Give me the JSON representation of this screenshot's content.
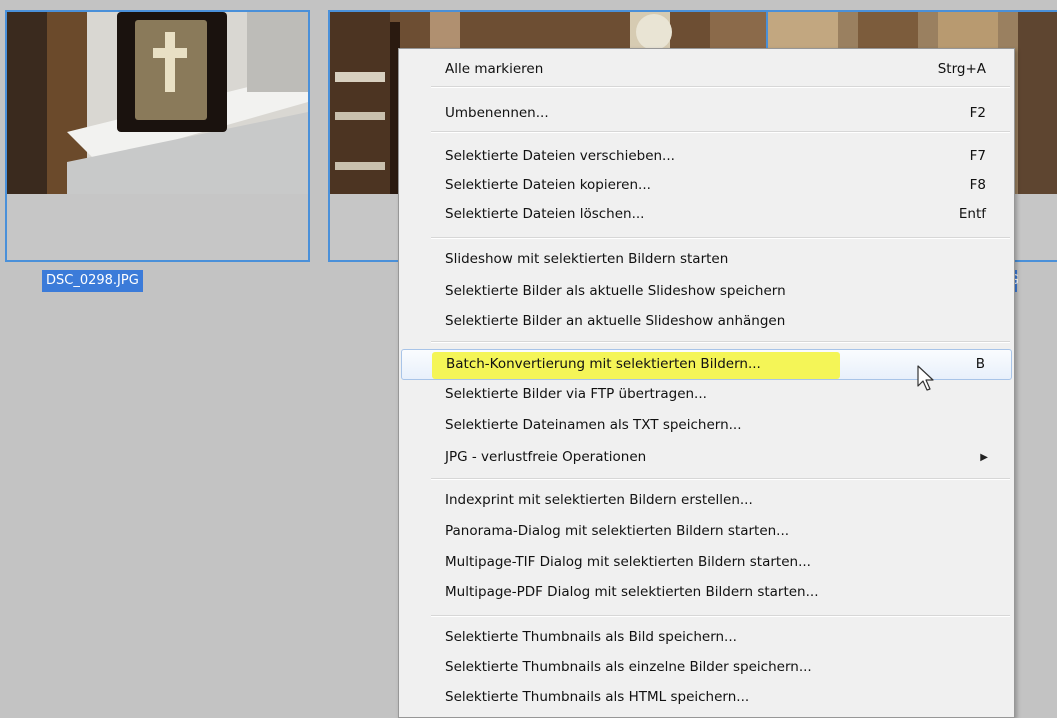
{
  "thumbnails": [
    {
      "filename": "DSC_0298.JPG"
    },
    {
      "filename": ""
    },
    {
      "filename": "PG"
    }
  ],
  "menu": {
    "items": [
      {
        "label": "Alle markieren",
        "shortcut": "Strg+A"
      },
      {
        "label": "Umbenennen...",
        "shortcut": "F2"
      },
      {
        "label": "Selektierte Dateien verschieben...",
        "shortcut": "F7"
      },
      {
        "label": "Selektierte Dateien kopieren...",
        "shortcut": "F8"
      },
      {
        "label": "Selektierte Dateien löschen...",
        "shortcut": "Entf"
      },
      {
        "label": "Slideshow mit selektierten Bildern starten",
        "shortcut": ""
      },
      {
        "label": "Selektierte Bilder als aktuelle Slideshow speichern",
        "shortcut": ""
      },
      {
        "label": "Selektierte Bilder an aktuelle Slideshow anhängen",
        "shortcut": ""
      },
      {
        "label": "Batch-Konvertierung mit selektierten Bildern...",
        "shortcut": "B"
      },
      {
        "label": "Selektierte Bilder via FTP übertragen...",
        "shortcut": ""
      },
      {
        "label": "Selektierte Dateinamen als TXT speichern...",
        "shortcut": ""
      },
      {
        "label": "JPG - verlustfreie Operationen",
        "shortcut": "",
        "submenu": true
      },
      {
        "label": "Indexprint mit selektierten Bildern erstellen...",
        "shortcut": ""
      },
      {
        "label": "Panorama-Dialog mit selektierten Bildern starten...",
        "shortcut": ""
      },
      {
        "label": "Multipage-TIF Dialog mit selektierten Bildern starten...",
        "shortcut": ""
      },
      {
        "label": "Multipage-PDF Dialog mit selektierten Bildern starten...",
        "shortcut": ""
      },
      {
        "label": "Selektierte Thumbnails als Bild speichern...",
        "shortcut": ""
      },
      {
        "label": "Selektierte Thumbnails als einzelne Bilder speichern...",
        "shortcut": ""
      },
      {
        "label": "Selektierte Thumbnails als HTML speichern...",
        "shortcut": ""
      }
    ],
    "highlight_color": "#f4f557",
    "submenu_icon": "chevron-right-icon"
  },
  "selection_color": "#3b7bd9"
}
